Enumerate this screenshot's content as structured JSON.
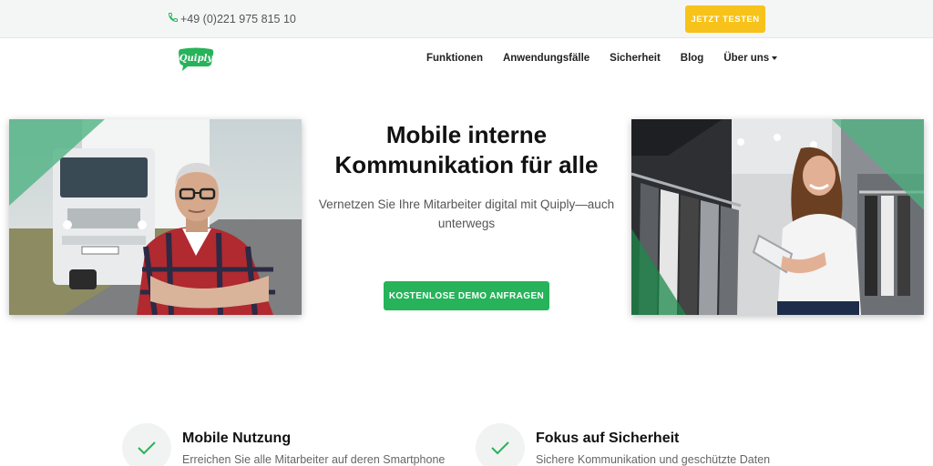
{
  "topbar": {
    "phone": "+49 (0)221 975 815 10",
    "cta_label": "JETZT TESTEN",
    "accent": "#f7c21a"
  },
  "brand": {
    "logo_text": "Quiply",
    "color": "#26b35a"
  },
  "nav": {
    "items": [
      {
        "label": "Funktionen"
      },
      {
        "label": "Anwendungsfälle"
      },
      {
        "label": "Sicherheit"
      },
      {
        "label": "Blog"
      },
      {
        "label": "Über uns",
        "dropdown": true
      }
    ]
  },
  "hero": {
    "title": "Mobile interne Kommunikation für alle",
    "subtitle": "Vernetzen Sie Ihre Mitarbeiter digital mit Quiply—auch unterwegs",
    "cta_label": "KOSTENLOSE DEMO ANFRAGEN",
    "left_image_icon": "truck-driver-photo",
    "right_image_icon": "retail-worker-photo"
  },
  "features": [
    {
      "icon": "check-icon",
      "title": "Mobile Nutzung",
      "text": "Erreichen Sie alle Mitarbeiter auf deren Smartphone"
    },
    {
      "icon": "check-icon",
      "title": "Fokus auf Sicherheit",
      "text": "Sichere Kommunikation und geschützte Daten"
    }
  ]
}
